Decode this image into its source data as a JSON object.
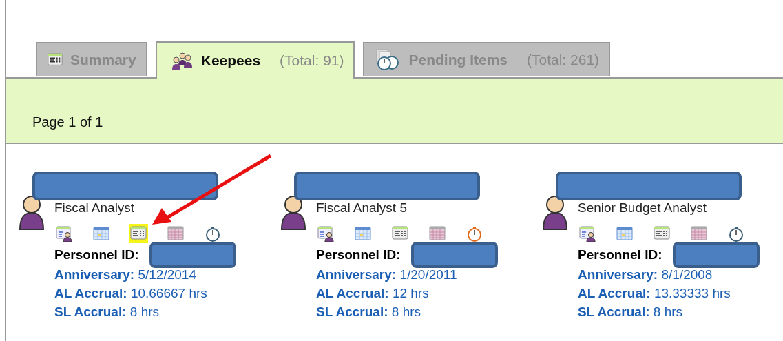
{
  "tabs": [
    {
      "kind": "summary",
      "label": "Summary",
      "selected": false
    },
    {
      "kind": "people",
      "label": "Keepees",
      "total": "(Total:  91)",
      "selected": true
    },
    {
      "kind": "pending",
      "label": "Pending Items",
      "total": "(Total:  261)",
      "selected": false
    }
  ],
  "pager": "Page 1 of 1",
  "cards": [
    {
      "title": "Fiscal Analyst",
      "icons": [
        {
          "kind": "profile",
          "highlighted": false
        },
        {
          "kind": "calendar",
          "highlighted": false
        },
        {
          "kind": "table",
          "highlighted": true
        },
        {
          "kind": "grid",
          "highlighted": false
        },
        {
          "kind": "timer",
          "alert": false,
          "highlighted": false
        }
      ],
      "id_label": "Personnel ID:",
      "fields": [
        {
          "label": "Anniversary:",
          "value": "5/12/2014"
        },
        {
          "label": "AL Accrual:",
          "value": "10.66667 hrs"
        },
        {
          "label": "SL Accrual:",
          "value": "8 hrs"
        }
      ]
    },
    {
      "title": "Fiscal Analyst 5",
      "icons": [
        {
          "kind": "profile",
          "highlighted": false
        },
        {
          "kind": "calendar",
          "highlighted": false
        },
        {
          "kind": "table",
          "highlighted": false
        },
        {
          "kind": "grid",
          "highlighted": false
        },
        {
          "kind": "timer",
          "alert": true,
          "highlighted": false
        }
      ],
      "id_label": "Personnel ID:",
      "fields": [
        {
          "label": "Anniversary:",
          "value": "1/20/2011"
        },
        {
          "label": "AL Accrual:",
          "value": "12 hrs"
        },
        {
          "label": "SL Accrual:",
          "value": "8 hrs"
        }
      ]
    },
    {
      "title": "Senior Budget Analyst",
      "icons": [
        {
          "kind": "profile",
          "highlighted": false
        },
        {
          "kind": "calendar",
          "highlighted": false
        },
        {
          "kind": "table",
          "highlighted": false
        },
        {
          "kind": "grid",
          "highlighted": false
        },
        {
          "kind": "timer",
          "alert": false,
          "highlighted": false
        }
      ],
      "id_label": "Personnel ID:",
      "fields": [
        {
          "label": "Anniversary:",
          "value": "8/1/2008"
        },
        {
          "label": "AL Accrual:",
          "value": "13.33333 hrs"
        },
        {
          "label": "SL Accrual:",
          "value": "8 hrs"
        }
      ]
    }
  ]
}
